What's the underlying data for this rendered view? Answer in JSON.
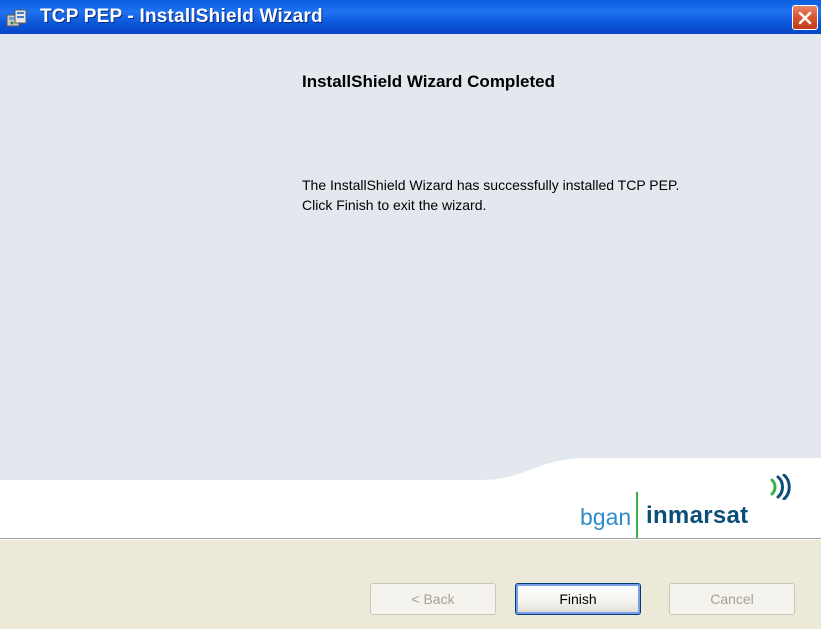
{
  "window": {
    "title": "TCP PEP - InstallShield Wizard"
  },
  "content": {
    "heading": "InstallShield Wizard Completed",
    "message_line1": "The InstallShield Wizard has successfully installed TCP PEP.",
    "message_line2": "Click Finish to exit the wizard."
  },
  "logo": {
    "left_text": "bgan",
    "right_text": "inmarsat"
  },
  "buttons": {
    "back": "< Back",
    "finish": "Finish",
    "cancel": "Cancel"
  },
  "colors": {
    "titlebar": "#0a5fe0",
    "content_background": "#e3e8ee",
    "footer_background": "#ece9d8",
    "close_button": "#d8542f",
    "logo_blue": "#2f8cc8",
    "logo_navy": "#0b4f79",
    "logo_green": "#3bb04a"
  },
  "icons": {
    "app": "installer-icon",
    "close": "close-icon",
    "logo_signal": "signal-waves-icon"
  }
}
